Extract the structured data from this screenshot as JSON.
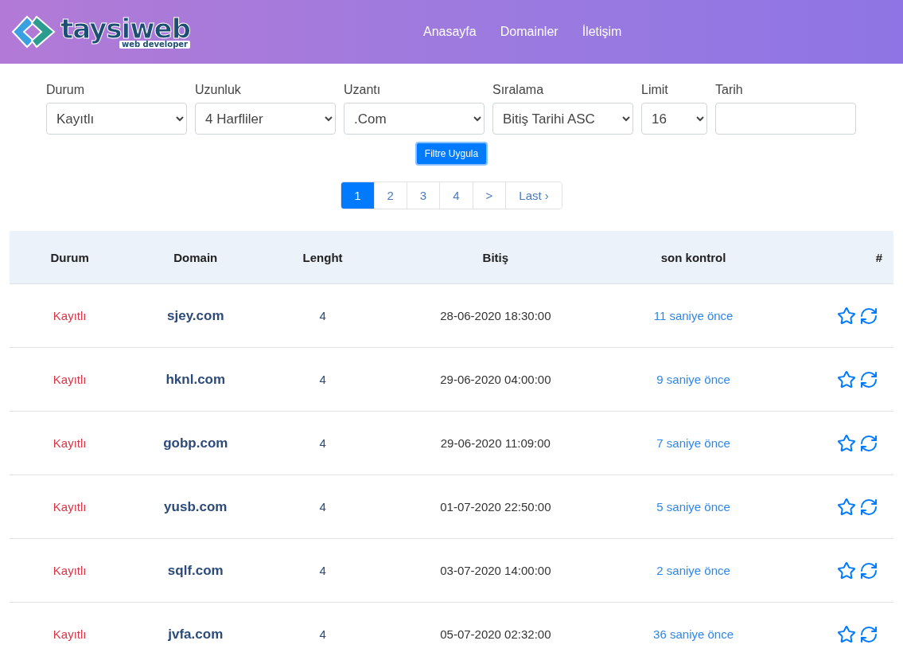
{
  "logo": {
    "name": "taysiweb",
    "tagline": "web developer"
  },
  "nav": [
    {
      "label": "Anasayfa"
    },
    {
      "label": "Domainler"
    },
    {
      "label": "İletişim"
    }
  ],
  "filters": [
    {
      "kind": "select",
      "label": "Durum",
      "value": "Kayıtlı"
    },
    {
      "kind": "select",
      "label": "Uzunluk",
      "value": "4 Harfliler"
    },
    {
      "kind": "select",
      "label": "Uzantı",
      "value": ".Com"
    },
    {
      "kind": "select",
      "label": "Sıralama",
      "value": "Bitiş Tarihi ASC"
    },
    {
      "kind": "select",
      "label": "Limit",
      "value": "16"
    },
    {
      "kind": "input",
      "label": "Tarih"
    }
  ],
  "apply_button": "Filtre Uygula",
  "pagination": [
    {
      "label": "1",
      "selected": true
    },
    {
      "label": "2",
      "selected": false
    },
    {
      "label": "3",
      "selected": false
    },
    {
      "label": "4",
      "selected": false
    },
    {
      "label": ">",
      "selected": false
    },
    {
      "label": "Last ›",
      "selected": false
    }
  ],
  "table": {
    "columns": [
      "Durum",
      "Domain",
      "Lenght",
      "Bitiş",
      "son kontrol",
      "#"
    ],
    "rows": [
      {
        "status": "Kayıtlı",
        "domain": "sjey.com",
        "length": "4",
        "expiry": "28-06-2020 18:30:00",
        "checked": "11 saniye önce"
      },
      {
        "status": "Kayıtlı",
        "domain": "hknl.com",
        "length": "4",
        "expiry": "29-06-2020 04:00:00",
        "checked": "9 saniye önce"
      },
      {
        "status": "Kayıtlı",
        "domain": "gobp.com",
        "length": "4",
        "expiry": "29-06-2020 11:09:00",
        "checked": "7 saniye önce"
      },
      {
        "status": "Kayıtlı",
        "domain": "yusb.com",
        "length": "4",
        "expiry": "01-07-2020 22:50:00",
        "checked": "5 saniye önce"
      },
      {
        "status": "Kayıtlı",
        "domain": "sqlf.com",
        "length": "4",
        "expiry": "03-07-2020 14:00:00",
        "checked": "2 saniye önce"
      },
      {
        "status": "Kayıtlı",
        "domain": "jvfa.com",
        "length": "4",
        "expiry": "05-07-2020 02:32:00",
        "checked": "36 saniye önce"
      }
    ]
  }
}
